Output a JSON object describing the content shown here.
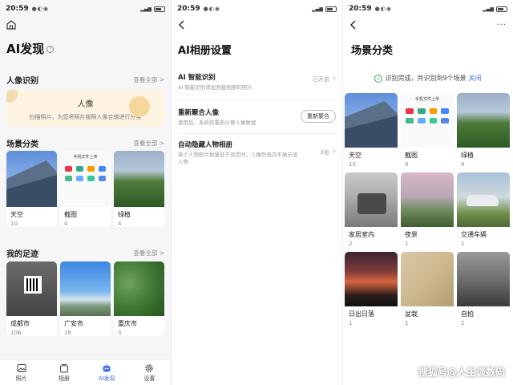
{
  "status": {
    "screen1_time": "20:59",
    "screen2_time": "20:59",
    "screen3_time": "20:59"
  },
  "screen1": {
    "title": "AI发现",
    "people": {
      "section_title": "人像识别",
      "more": "查看全部 >",
      "card_title": "人像",
      "card_desc": "扫描照片，为您将照片按照人像合辑进行分类"
    },
    "scenes": {
      "section_title": "场景分类",
      "more": "查看全部 >",
      "items": [
        {
          "label": "天空",
          "count": "10"
        },
        {
          "label": "截图",
          "count": "4"
        },
        {
          "label": "绿植",
          "count": "4"
        }
      ]
    },
    "footprints": {
      "section_title": "我的足迹",
      "more": "查看全部 >",
      "items": [
        {
          "label": "成都市",
          "count": "106"
        },
        {
          "label": "广安市",
          "count": "18"
        },
        {
          "label": "重庆市",
          "count": "3"
        }
      ]
    },
    "tabs": [
      {
        "label": "照片",
        "icon": "photo-icon"
      },
      {
        "label": "相册",
        "icon": "album-icon"
      },
      {
        "label": "AI发现",
        "icon": "ai-robot-icon"
      },
      {
        "label": "设置",
        "icon": "gear-icon"
      }
    ],
    "active_tab": "AI发现"
  },
  "screen2": {
    "title": "AI相册设置",
    "rows": [
      {
        "title": "AI 智能识别",
        "desc": "AI 智能识别添加到极相册的照片",
        "value": "已开启"
      },
      {
        "title": "重新聚合人像",
        "desc": "使用后，系统将重新计算人像数据",
        "button": "重新聚合"
      },
      {
        "title": "自动隐藏人物相册",
        "desc": "单个人物照片数量低于设定时，人像列表内不展示该人物",
        "value": "3张"
      }
    ]
  },
  "screen3": {
    "title": "场景分类",
    "notice": "识别完成，共识别到9个场景",
    "notice_close": "关闭",
    "items": [
      {
        "label": "天空",
        "count": "10"
      },
      {
        "label": "截图",
        "count": "4"
      },
      {
        "label": "绿植",
        "count": "4"
      },
      {
        "label": "家居室内",
        "count": "2"
      },
      {
        "label": "夜景",
        "count": "1"
      },
      {
        "label": "交通车辆",
        "count": "1"
      },
      {
        "label": "日出日落",
        "count": "1"
      },
      {
        "label": "盆栽",
        "count": "1"
      },
      {
        "label": "自拍",
        "count": "1"
      }
    ]
  },
  "screenshot_thumb": {
    "header": "手机文件上传"
  },
  "watermark": "搜狐号@人生谈数码",
  "colors": {
    "accent": "#3a6ee8",
    "success": "#3aa85a",
    "people_card_bg": "#fff4e2"
  }
}
